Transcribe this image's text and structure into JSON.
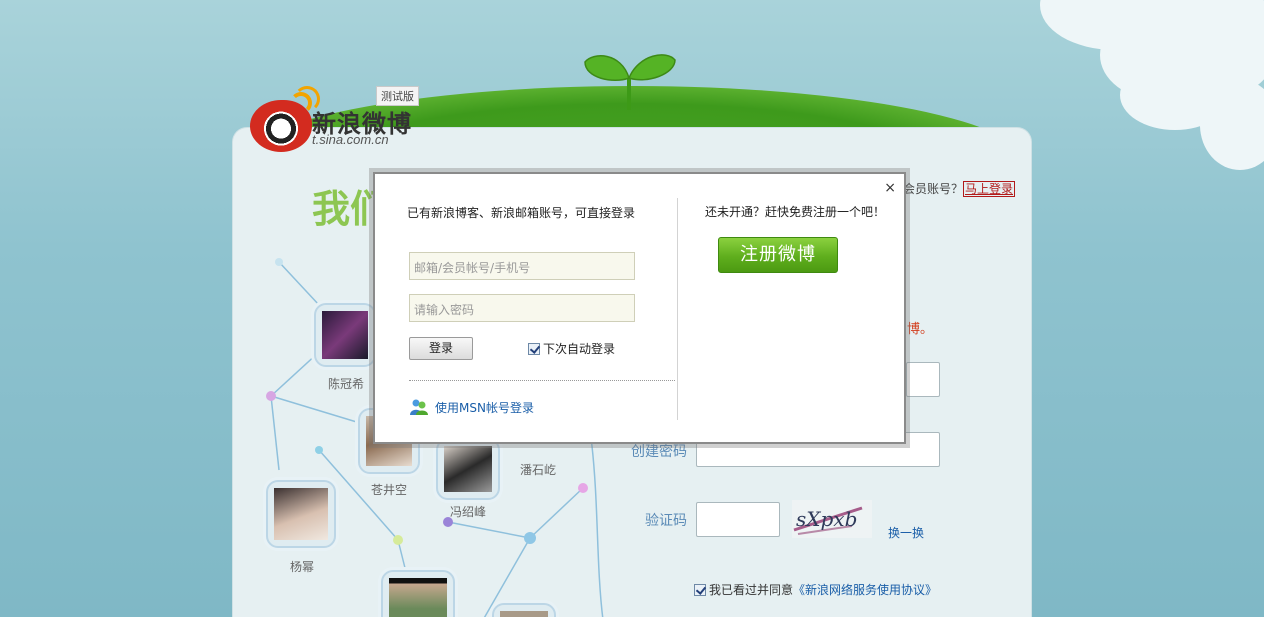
{
  "logo": {
    "brand_name": "新浪微博",
    "domain": "t.sina.com.cn",
    "beta_badge": "测试版"
  },
  "background": {
    "heading_fragment": "我们",
    "login_prompt": "会员账号？",
    "login_link": "马上登录",
    "red_text_fragment": "博。",
    "password_label": "创建密码",
    "captcha_label": "验证码",
    "captcha_text": "sXpxb",
    "refresh_link": "换一换",
    "agree_text": "我已看过并同意",
    "agree_link": "《新浪网络服务使用协议》",
    "agree_checked": true
  },
  "network": {
    "people": [
      {
        "name": "陈冠希"
      },
      {
        "name": "苍井空"
      },
      {
        "name": "冯绍峰"
      },
      {
        "name": "潘石屹"
      },
      {
        "name": "杨幂"
      }
    ]
  },
  "dialog": {
    "close_label": "×",
    "left_title": "已有新浪博客、新浪邮箱账号，可直接登录",
    "username_placeholder": "邮箱/会员帐号/手机号",
    "password_placeholder": "请输入密码",
    "login_button": "登录",
    "auto_login_label": "下次自动登录",
    "auto_login_checked": true,
    "msn_link": "使用MSN帐号登录",
    "right_title": "还未开通？赶快免费注册一个吧！",
    "register_button": "注册微博"
  },
  "colors": {
    "brand_green": "#5fae1d",
    "link_blue": "#1a5ea8",
    "link_red": "#b21a1a",
    "heading_green": "#8dc652"
  }
}
